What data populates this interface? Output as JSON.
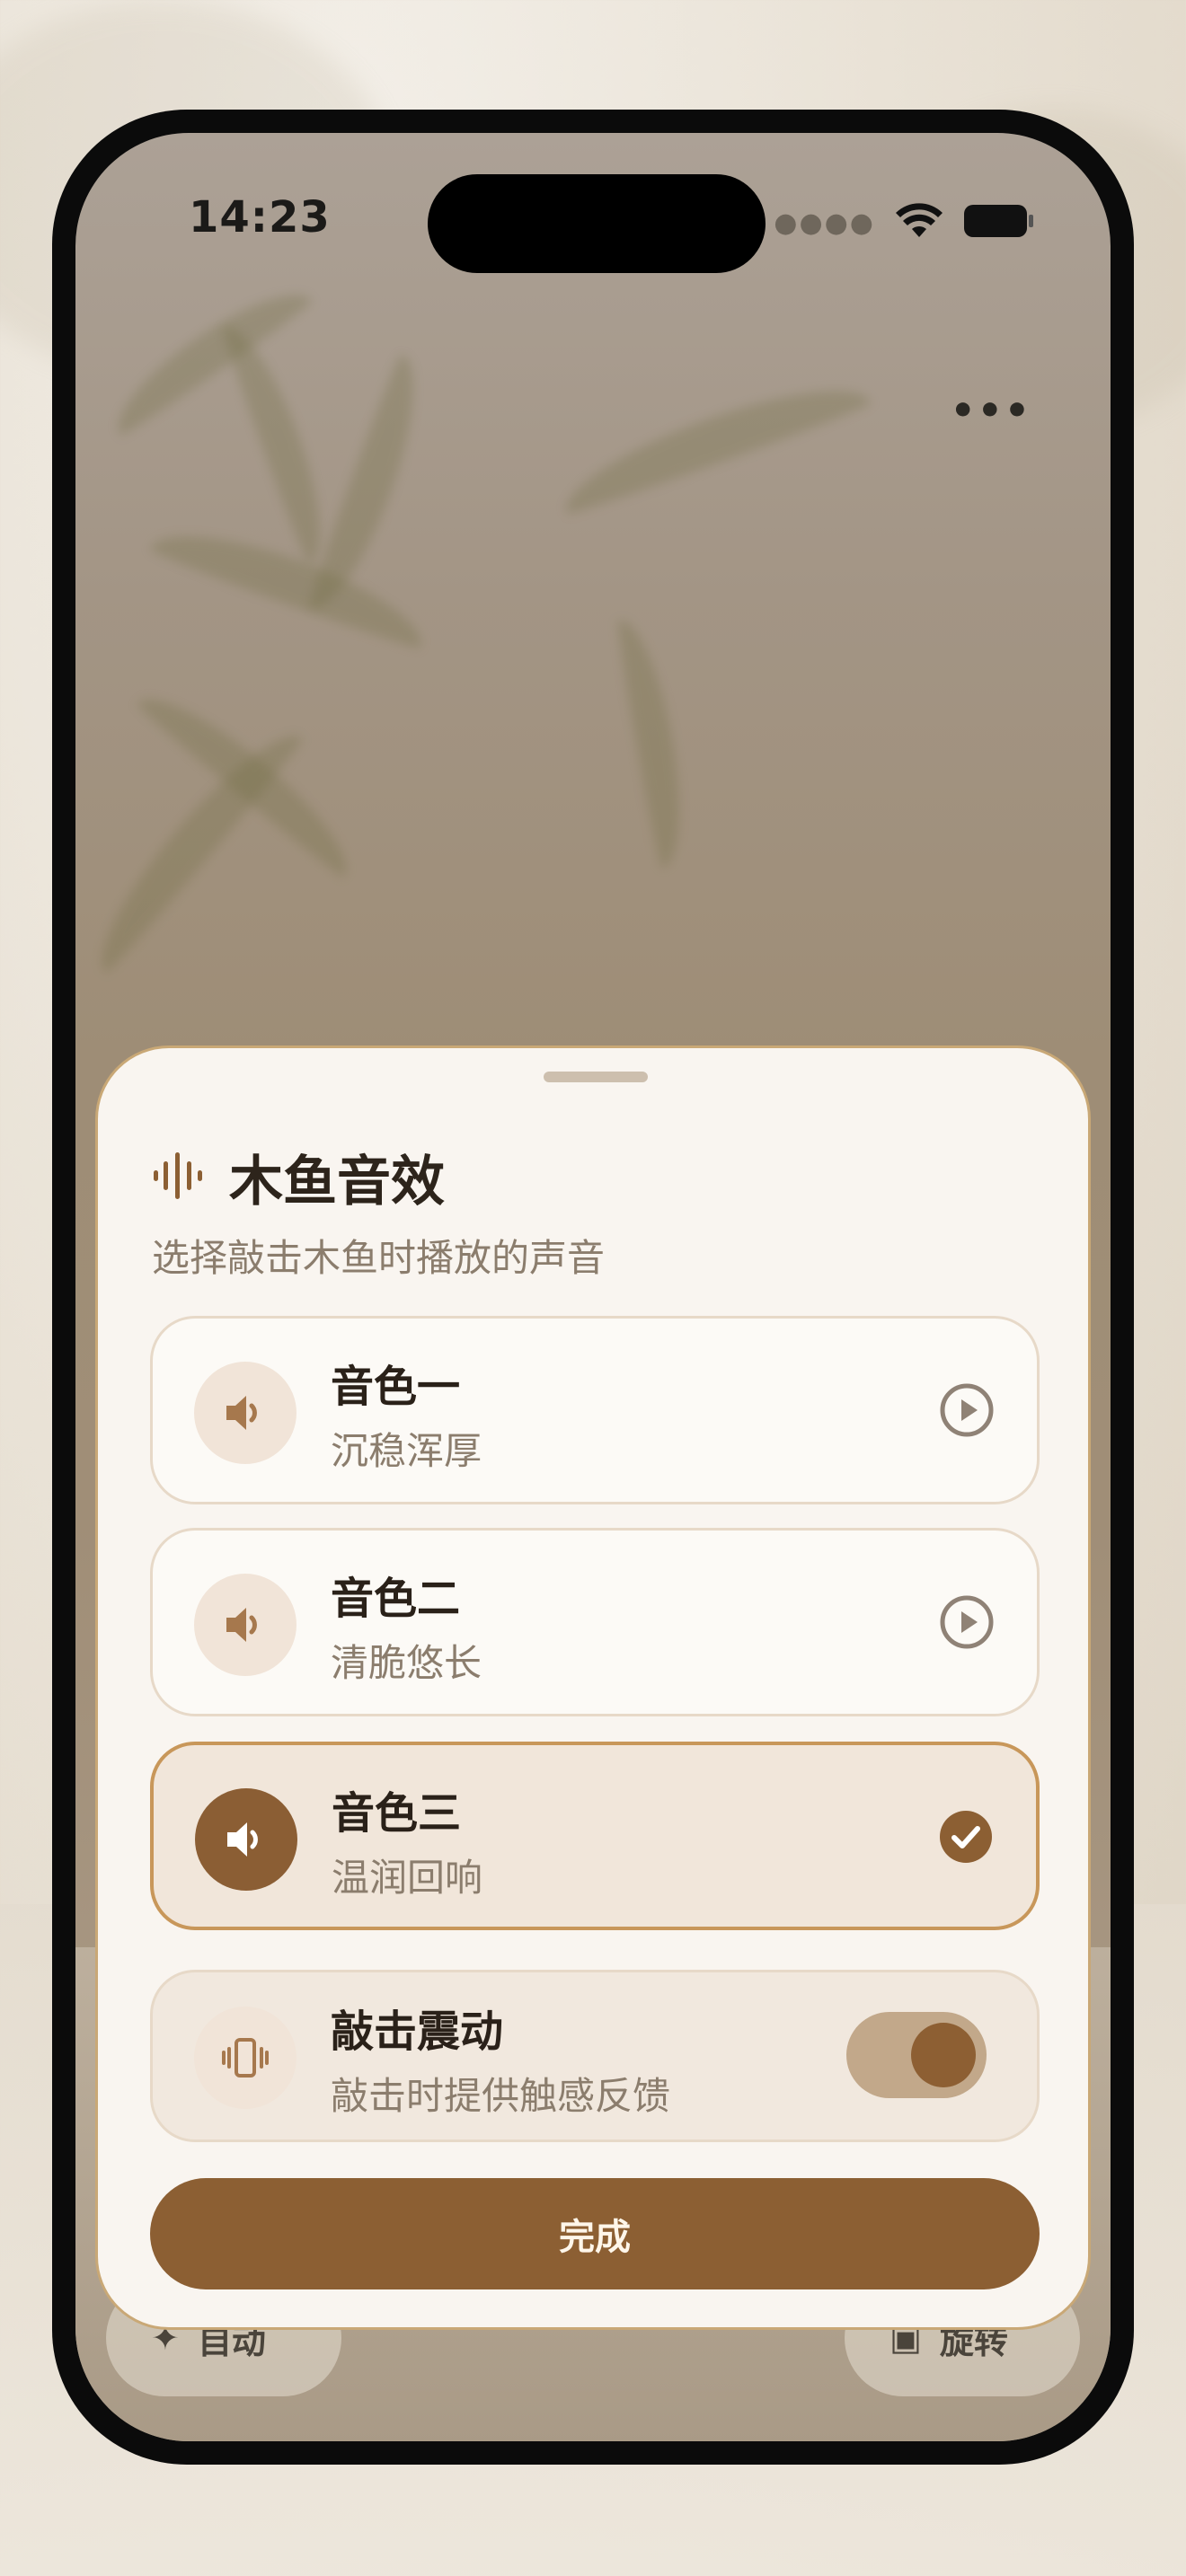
{
  "status_bar": {
    "time": "14:23",
    "signal_icon": "signal-dots-icon",
    "wifi_icon": "wifi-icon",
    "battery_icon": "battery-icon"
  },
  "top_bar": {
    "more_icon": "more-horizontal-icon",
    "more_label": "•••"
  },
  "background_buttons": {
    "left": {
      "icon": "sparkle-icon",
      "label": "自动"
    },
    "right": {
      "icon": "rotate-icon",
      "label": "旋转"
    }
  },
  "sheet": {
    "icon": "sound-wave-icon",
    "title": "木鱼音效",
    "subtitle": "选择敲击木鱼时播放的声音",
    "options": [
      {
        "title": "音色一",
        "desc": "沉稳浑厚",
        "selected": false,
        "icon": "speaker-icon",
        "action_icon": "play-icon"
      },
      {
        "title": "音色二",
        "desc": "清脆悠长",
        "selected": false,
        "icon": "speaker-icon",
        "action_icon": "play-icon"
      },
      {
        "title": "音色三",
        "desc": "温润回响",
        "selected": true,
        "icon": "speaker-icon",
        "action_icon": "check-icon"
      }
    ],
    "vibration": {
      "title": "敲击震动",
      "desc": "敲击时提供触感反馈",
      "enabled": true,
      "icon": "vibrate-icon"
    },
    "done_label": "完成"
  },
  "colors": {
    "accent": "#8c5f33",
    "selected_border": "#c8975a",
    "sheet_bg": "#f9f5f0"
  }
}
